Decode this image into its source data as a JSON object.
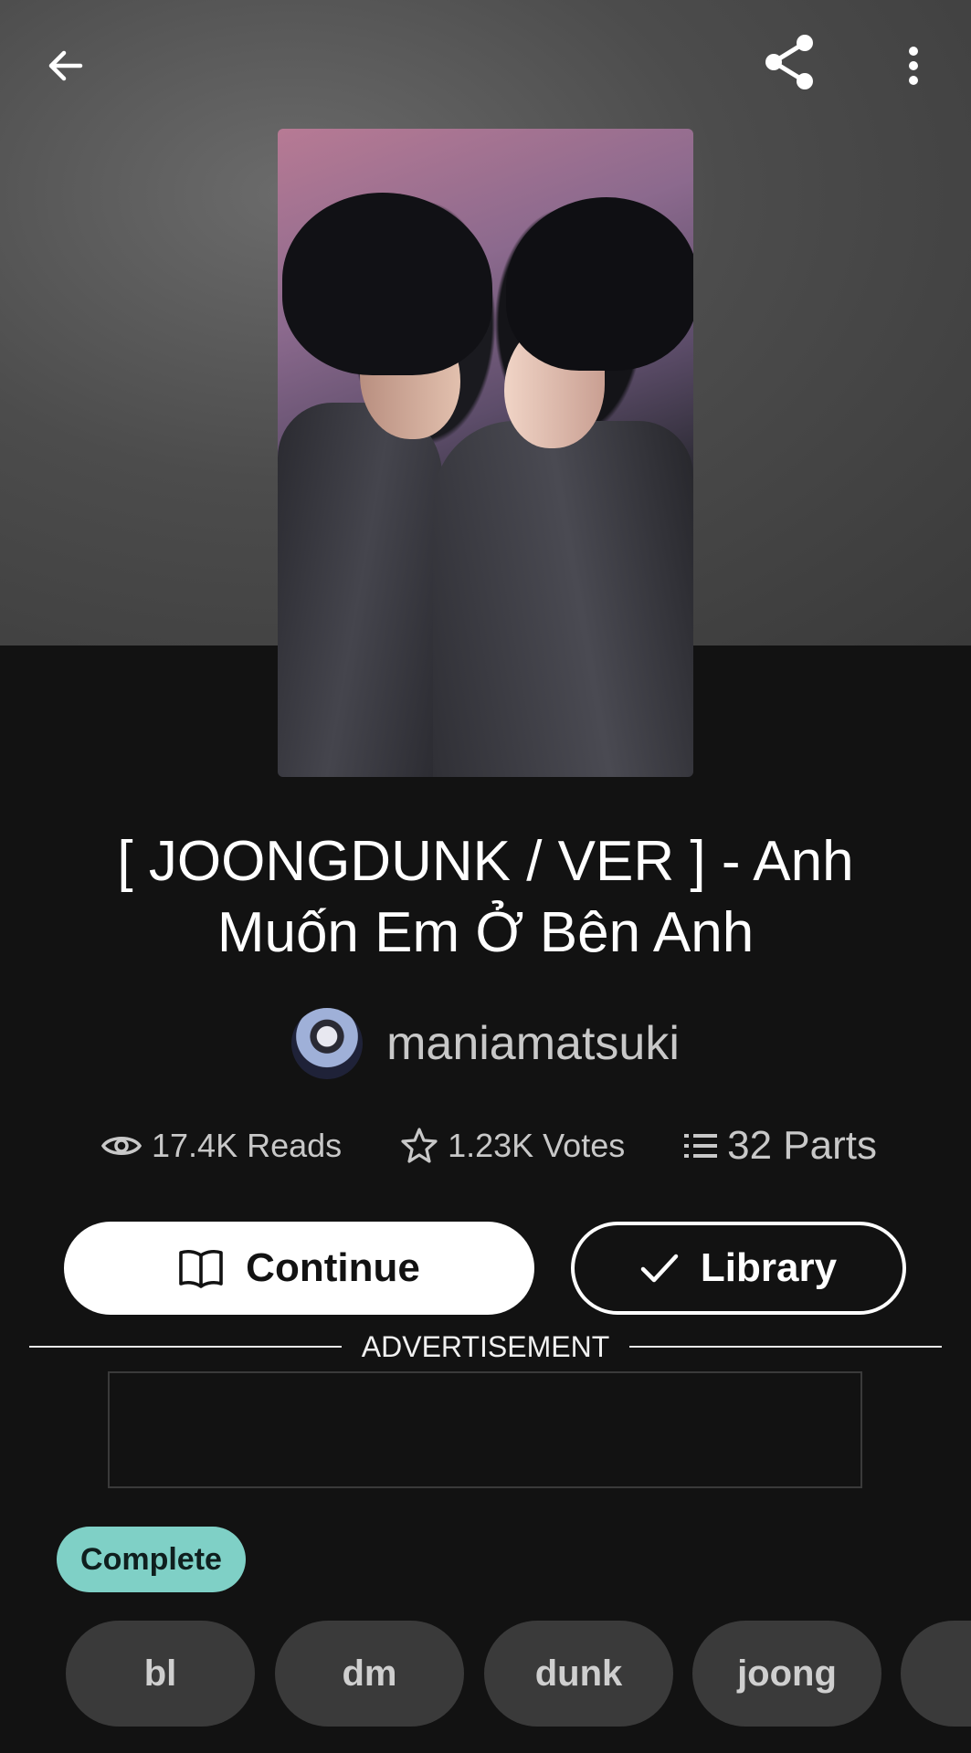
{
  "header": {
    "back_icon": "back-arrow-icon",
    "share_icon": "share-icon",
    "more_icon": "more-vertical-icon"
  },
  "story": {
    "title_line1": "[ JOONGDUNK / VER ] - Anh",
    "title_line2": "Muốn Em Ở Bên Anh",
    "author": "maniamatsuki",
    "reads": "17.4K Reads",
    "votes": "1.23K Votes",
    "parts": "32 Parts",
    "status": "Complete"
  },
  "actions": {
    "continue_label": "Continue",
    "library_label": "Library"
  },
  "advertisement": {
    "label": "ADVERTISEMENT"
  },
  "tags": [
    "bl",
    "dm",
    "dunk",
    "joong",
    ""
  ],
  "colors": {
    "background": "#121212",
    "status_pill": "#7fd0c6",
    "tag_bg": "#3a3a3a"
  }
}
